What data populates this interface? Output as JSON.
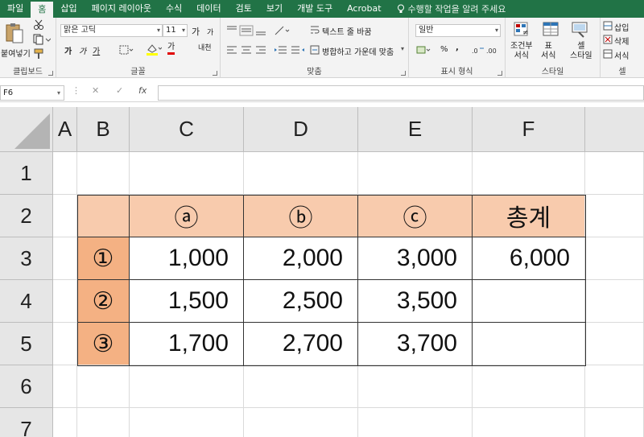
{
  "tabs": [
    "파일",
    "홈",
    "삽입",
    "페이지 레이아웃",
    "수식",
    "데이터",
    "검토",
    "보기",
    "개발 도구",
    "Acrobat"
  ],
  "active_tab": "홈",
  "tell_me": "수행할 작업을 알려 주세요",
  "ribbon": {
    "clipboard": {
      "paste_label": "붙여넣기",
      "group": "클립보드"
    },
    "font": {
      "name": "맑은 고딕",
      "size": "11",
      "grow": "가",
      "shrink": "가",
      "bold": "가",
      "italic": "가",
      "underline": "가",
      "font_color_glyph": "가",
      "phonetic": "내천",
      "group": "글꼴"
    },
    "alignment": {
      "wrap_text": "텍스트 줄 바꿈",
      "merge_center": "병합하고 가운데 맞춤",
      "group": "맞춤"
    },
    "number": {
      "format": "일반",
      "percent": "%",
      "comma": ",",
      "group": "표시 형식"
    },
    "styles": {
      "conditional": [
        "조건부",
        "서식"
      ],
      "table": [
        "표",
        "서식"
      ],
      "cell_styles": [
        "셀",
        "스타일"
      ],
      "group": "스타일"
    },
    "cells": {
      "insert": "삽입",
      "delete": "삭제",
      "format": "서식",
      "group": "셀"
    }
  },
  "formula_bar": {
    "name_box": "F6",
    "fx": "fx",
    "value": ""
  },
  "columns": [
    "A",
    "B",
    "C",
    "D",
    "E",
    "F"
  ],
  "rows": [
    "1",
    "2",
    "3",
    "4",
    "5",
    "6",
    "7"
  ],
  "sheet": {
    "header": [
      "",
      "ⓐ",
      "ⓑ",
      "ⓒ",
      "총계"
    ],
    "body": [
      [
        "①",
        "1,000",
        "2,000",
        "3,000",
        "6,000"
      ],
      [
        "②",
        "1,500",
        "2,500",
        "3,500",
        ""
      ],
      [
        "③",
        "1,700",
        "2,700",
        "3,700",
        ""
      ]
    ]
  },
  "colors": {
    "ribbon_green": "#217346",
    "header_fill": "#F8CBAD",
    "row_label_fill": "#F4B183"
  }
}
